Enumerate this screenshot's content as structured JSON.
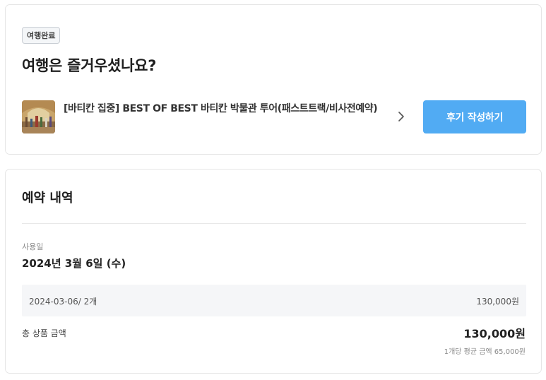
{
  "status_card": {
    "badge": "여행완료",
    "headline": "여행은 즐거우셨나요?",
    "product_title": "[바티칸 집중] BEST OF BEST 바티칸 박물관 투어(패스트트랙/비사전예약)",
    "review_button": "후기 작성하기"
  },
  "booking_card": {
    "title": "예약 내역",
    "use_date_label": "사용일",
    "use_date": "2024년 3월 6일 (수)",
    "options": [
      {
        "name": "2024-03-06/ 2개",
        "price": "130,000원"
      }
    ],
    "total_label": "총 상품 금액",
    "total_amount": "130,000원",
    "average_note": "1개당 평균 금액 65,000원"
  },
  "colors": {
    "accent": "#51abf3",
    "badge_border": "#c9ced4",
    "row_bg": "#f5f6f8"
  },
  "icons": {
    "thumbnail": "vatican-painting-thumbnail",
    "chevron": "chevron-right-icon"
  }
}
